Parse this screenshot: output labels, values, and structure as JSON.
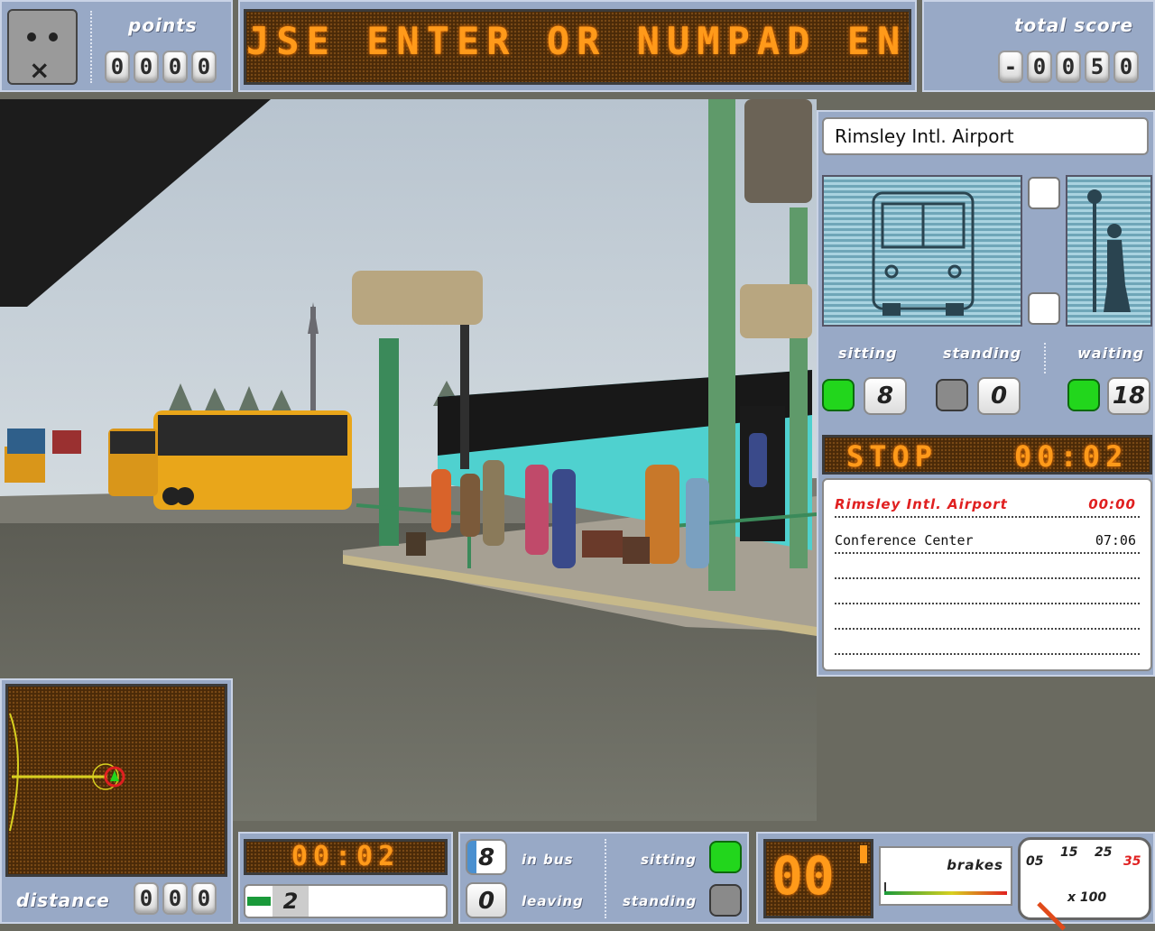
{
  "hud": {
    "points_label": "points",
    "points_digits": [
      "0",
      "0",
      "0",
      "0"
    ],
    "ticker_text": "JSE ENTER OR NUMPAD ENTE",
    "total_score_label": "total score",
    "total_score_digits": [
      "-",
      "0",
      "0",
      "5",
      "0"
    ]
  },
  "stop_panel": {
    "current_stop": "Rimsley Intl. Airport",
    "sitting_label": "sitting",
    "standing_label": "standing",
    "waiting_label": "waiting",
    "sitting_count": "8",
    "standing_count": "0",
    "waiting_count": "18",
    "stop_timer_label": "STOP",
    "stop_timer_value": "00:02"
  },
  "schedule": {
    "rows": [
      {
        "stop": "Rimsley Intl. Airport",
        "time": "00:00",
        "current": true
      },
      {
        "stop": "Conference Center",
        "time": "07:06",
        "current": false
      },
      {
        "stop": "",
        "time": "",
        "current": false
      },
      {
        "stop": "",
        "time": "",
        "current": false
      },
      {
        "stop": "",
        "time": "",
        "current": false
      },
      {
        "stop": "",
        "time": "",
        "current": false
      }
    ]
  },
  "minimap": {
    "distance_label": "distance",
    "distance_digits": [
      "0",
      "0",
      "0"
    ]
  },
  "bottom_bar": {
    "clock_led": "00:02",
    "gear_value": "2",
    "in_bus_count": "8",
    "in_bus_label": "in bus",
    "leaving_count": "0",
    "leaving_label": "leaving",
    "sitting_label": "sitting",
    "standing_label": "standing",
    "speed_led": "00",
    "brakes_label": "brakes",
    "tacho_ticks": [
      "05",
      "15",
      "25",
      "35"
    ],
    "tacho_unit": "x 100"
  },
  "colors": {
    "panel": "#98a9c6",
    "led_text": "#ff9a1a",
    "current_stop_red": "#e02020",
    "happy_green": "#22d61c"
  }
}
